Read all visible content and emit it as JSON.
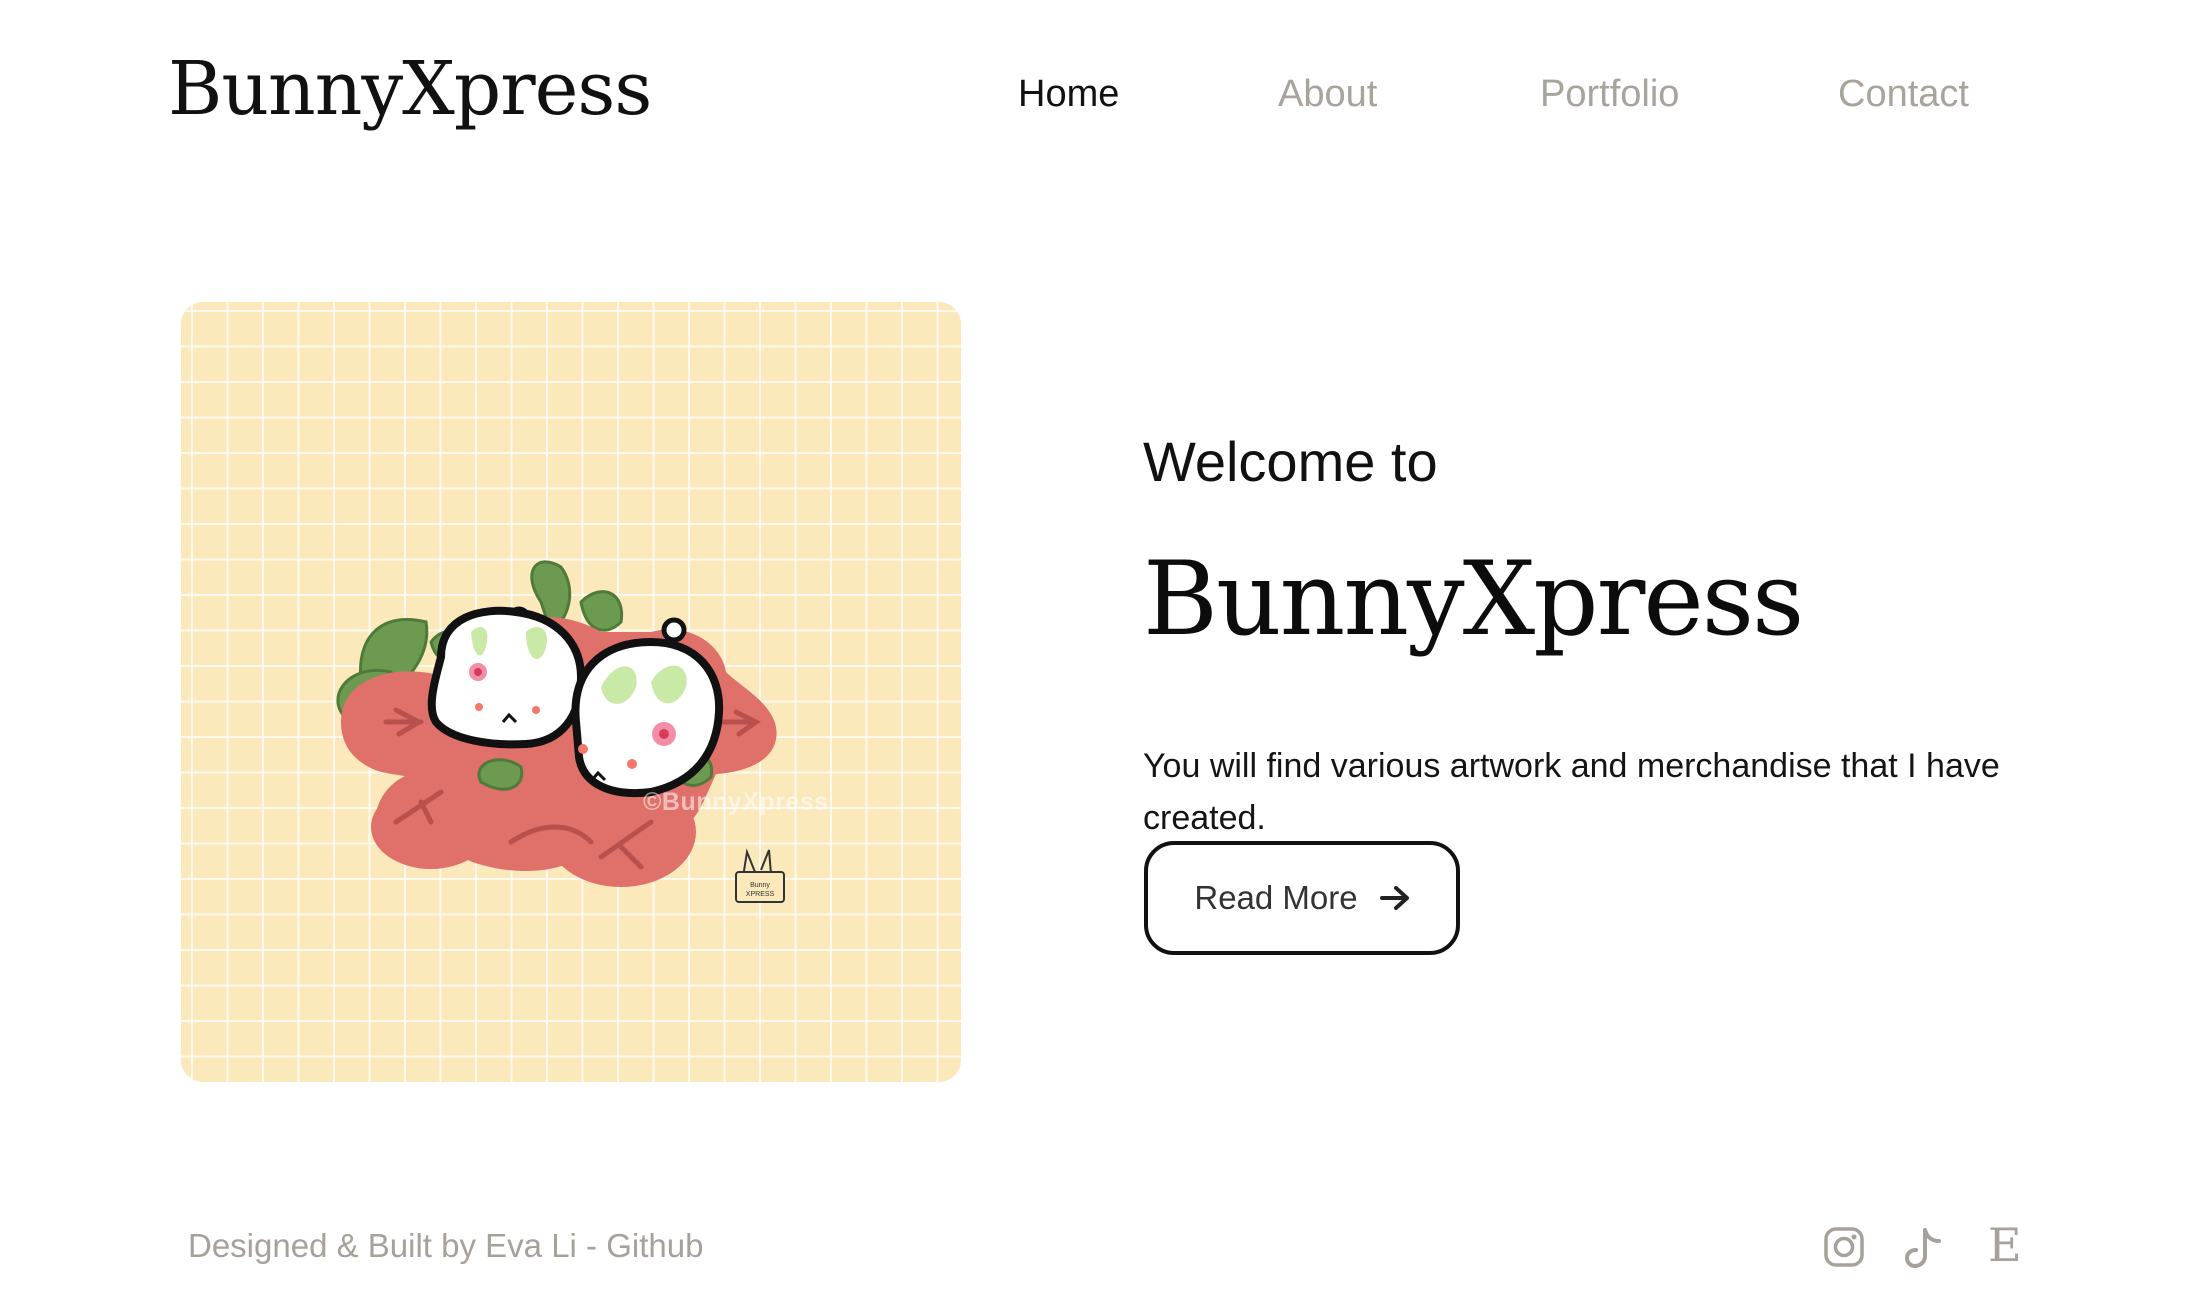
{
  "header": {
    "logo": "BunnyXpress",
    "nav": [
      {
        "label": "Home",
        "active": true
      },
      {
        "label": "About",
        "active": false
      },
      {
        "label": "Portfolio",
        "active": false
      },
      {
        "label": "Contact",
        "active": false
      }
    ]
  },
  "hero": {
    "artwork": {
      "watermark": "©BunnyXpress",
      "stamp_text": "Bunny XPRESS",
      "icon": "bunny-strawberry-illustration"
    },
    "welcome": "Welcome to",
    "brand": "BunnyXpress",
    "description": "You will find various artwork and merchandise that I have created.",
    "read_more_label": "Read More",
    "read_more_icon": "arrow-right-icon"
  },
  "footer": {
    "credit_prefix": "Designed & Built by Eva Li - ",
    "credit_link": "Github",
    "social": [
      {
        "name": "instagram-icon"
      },
      {
        "name": "tiktok-icon"
      },
      {
        "name": "etsy-icon",
        "glyph": "E"
      }
    ]
  },
  "colors": {
    "text_primary": "#111111",
    "text_muted": "#a8a39b",
    "art_background": "#fbe9bc",
    "strawberry_red": "#e0706a",
    "leaf_green": "#6c9a50",
    "leaf_light": "#c9eaa6",
    "blossom_pink": "#f28fa6"
  }
}
